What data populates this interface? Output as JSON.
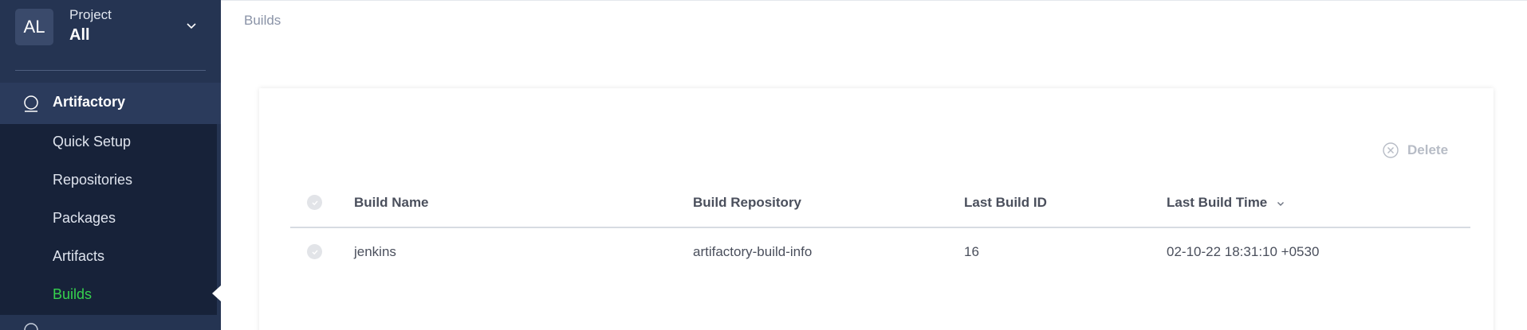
{
  "sidebar": {
    "avatar": "AL",
    "project_label": "Project",
    "project_value": "All",
    "section_label": "Artifactory",
    "items": [
      {
        "label": "Quick Setup"
      },
      {
        "label": "Repositories"
      },
      {
        "label": "Packages"
      },
      {
        "label": "Artifacts"
      },
      {
        "label": "Builds",
        "active": true
      }
    ]
  },
  "breadcrumb": "Builds",
  "toolbar": {
    "delete_label": "Delete"
  },
  "table": {
    "columns": [
      "Build Name",
      "Build Repository",
      "Last Build ID",
      "Last Build Time"
    ],
    "sorted_column": "Last Build Time",
    "rows": [
      {
        "build_name": "jenkins",
        "build_repository": "artifactory-build-info",
        "last_build_id": "16",
        "last_build_time": "02-10-22 18:31:10 +0530"
      }
    ]
  },
  "colors": {
    "sidebar_bg": "#253452",
    "submenu_bg": "#172239",
    "active": "#36d24e"
  }
}
